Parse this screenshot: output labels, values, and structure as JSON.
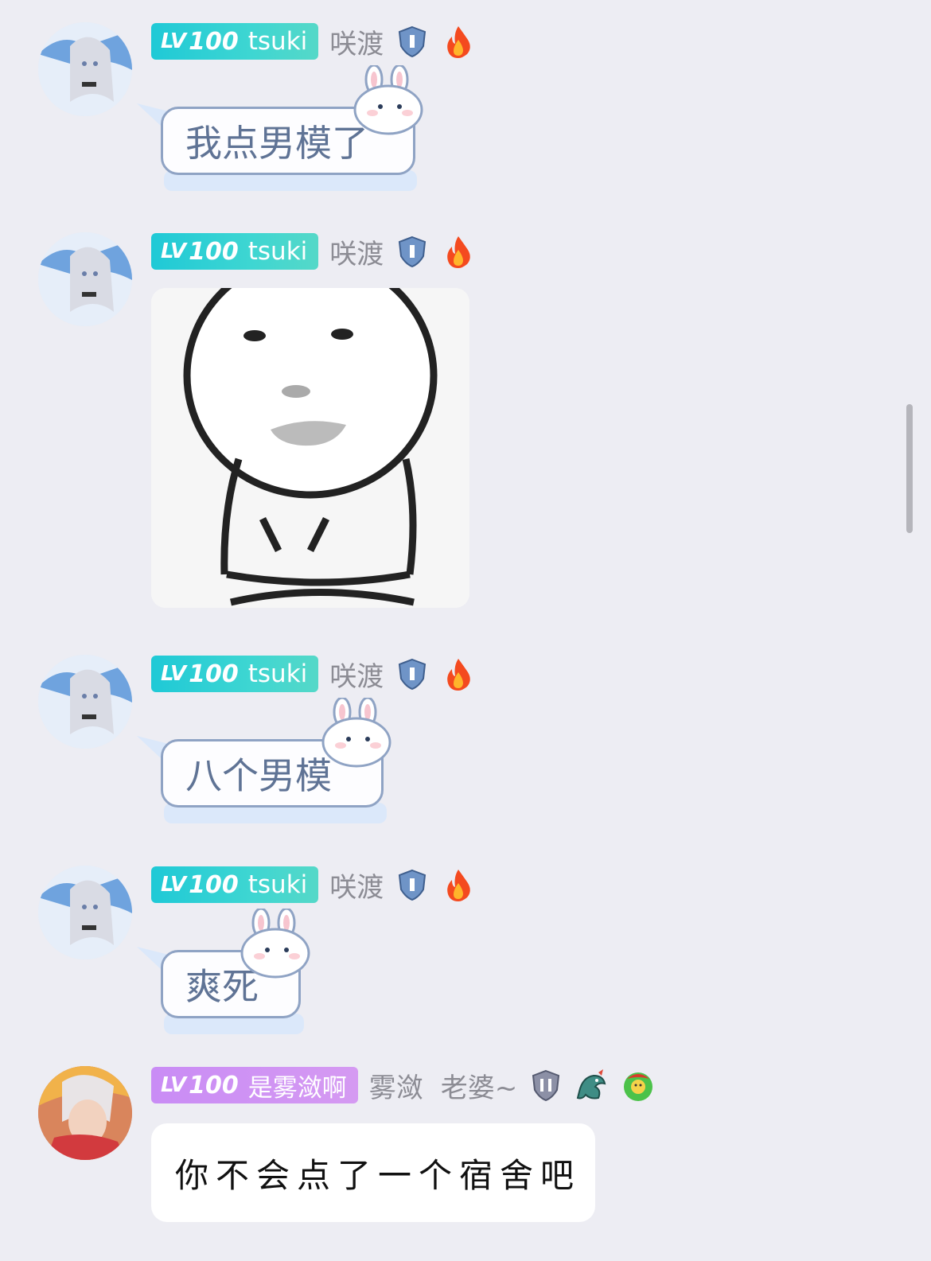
{
  "messages": [
    {
      "level_label": "LV",
      "level": "100",
      "badge_name": "tsuki",
      "nickname": "咲渡",
      "type": "text",
      "text": "我点男模了"
    },
    {
      "level_label": "LV",
      "level": "100",
      "badge_name": "tsuki",
      "nickname": "咲渡",
      "type": "sticker",
      "sticker": "meme-face-sticker"
    },
    {
      "level_label": "LV",
      "level": "100",
      "badge_name": "tsuki",
      "nickname": "咲渡",
      "type": "text",
      "text": "八个男模"
    },
    {
      "level_label": "LV",
      "level": "100",
      "badge_name": "tsuki",
      "nickname": "咲渡",
      "type": "text",
      "text": "爽死"
    },
    {
      "level_label": "LV",
      "level": "100",
      "badge_name": "是雾潋啊",
      "nickname": "雾潋",
      "remark": "老婆~",
      "type": "text",
      "text": "你不会点了一个宿舍吧"
    }
  ],
  "colors": {
    "background": "#ededf3",
    "badge_teal": "#1fc9d6",
    "badge_purple": "#c98cf5",
    "bubble_text": "#5f7395",
    "bubble_border": "#8fa3c4"
  },
  "icons": [
    "shield-rank-icon",
    "fire-icon",
    "dragon-icon",
    "green-face-icon"
  ]
}
